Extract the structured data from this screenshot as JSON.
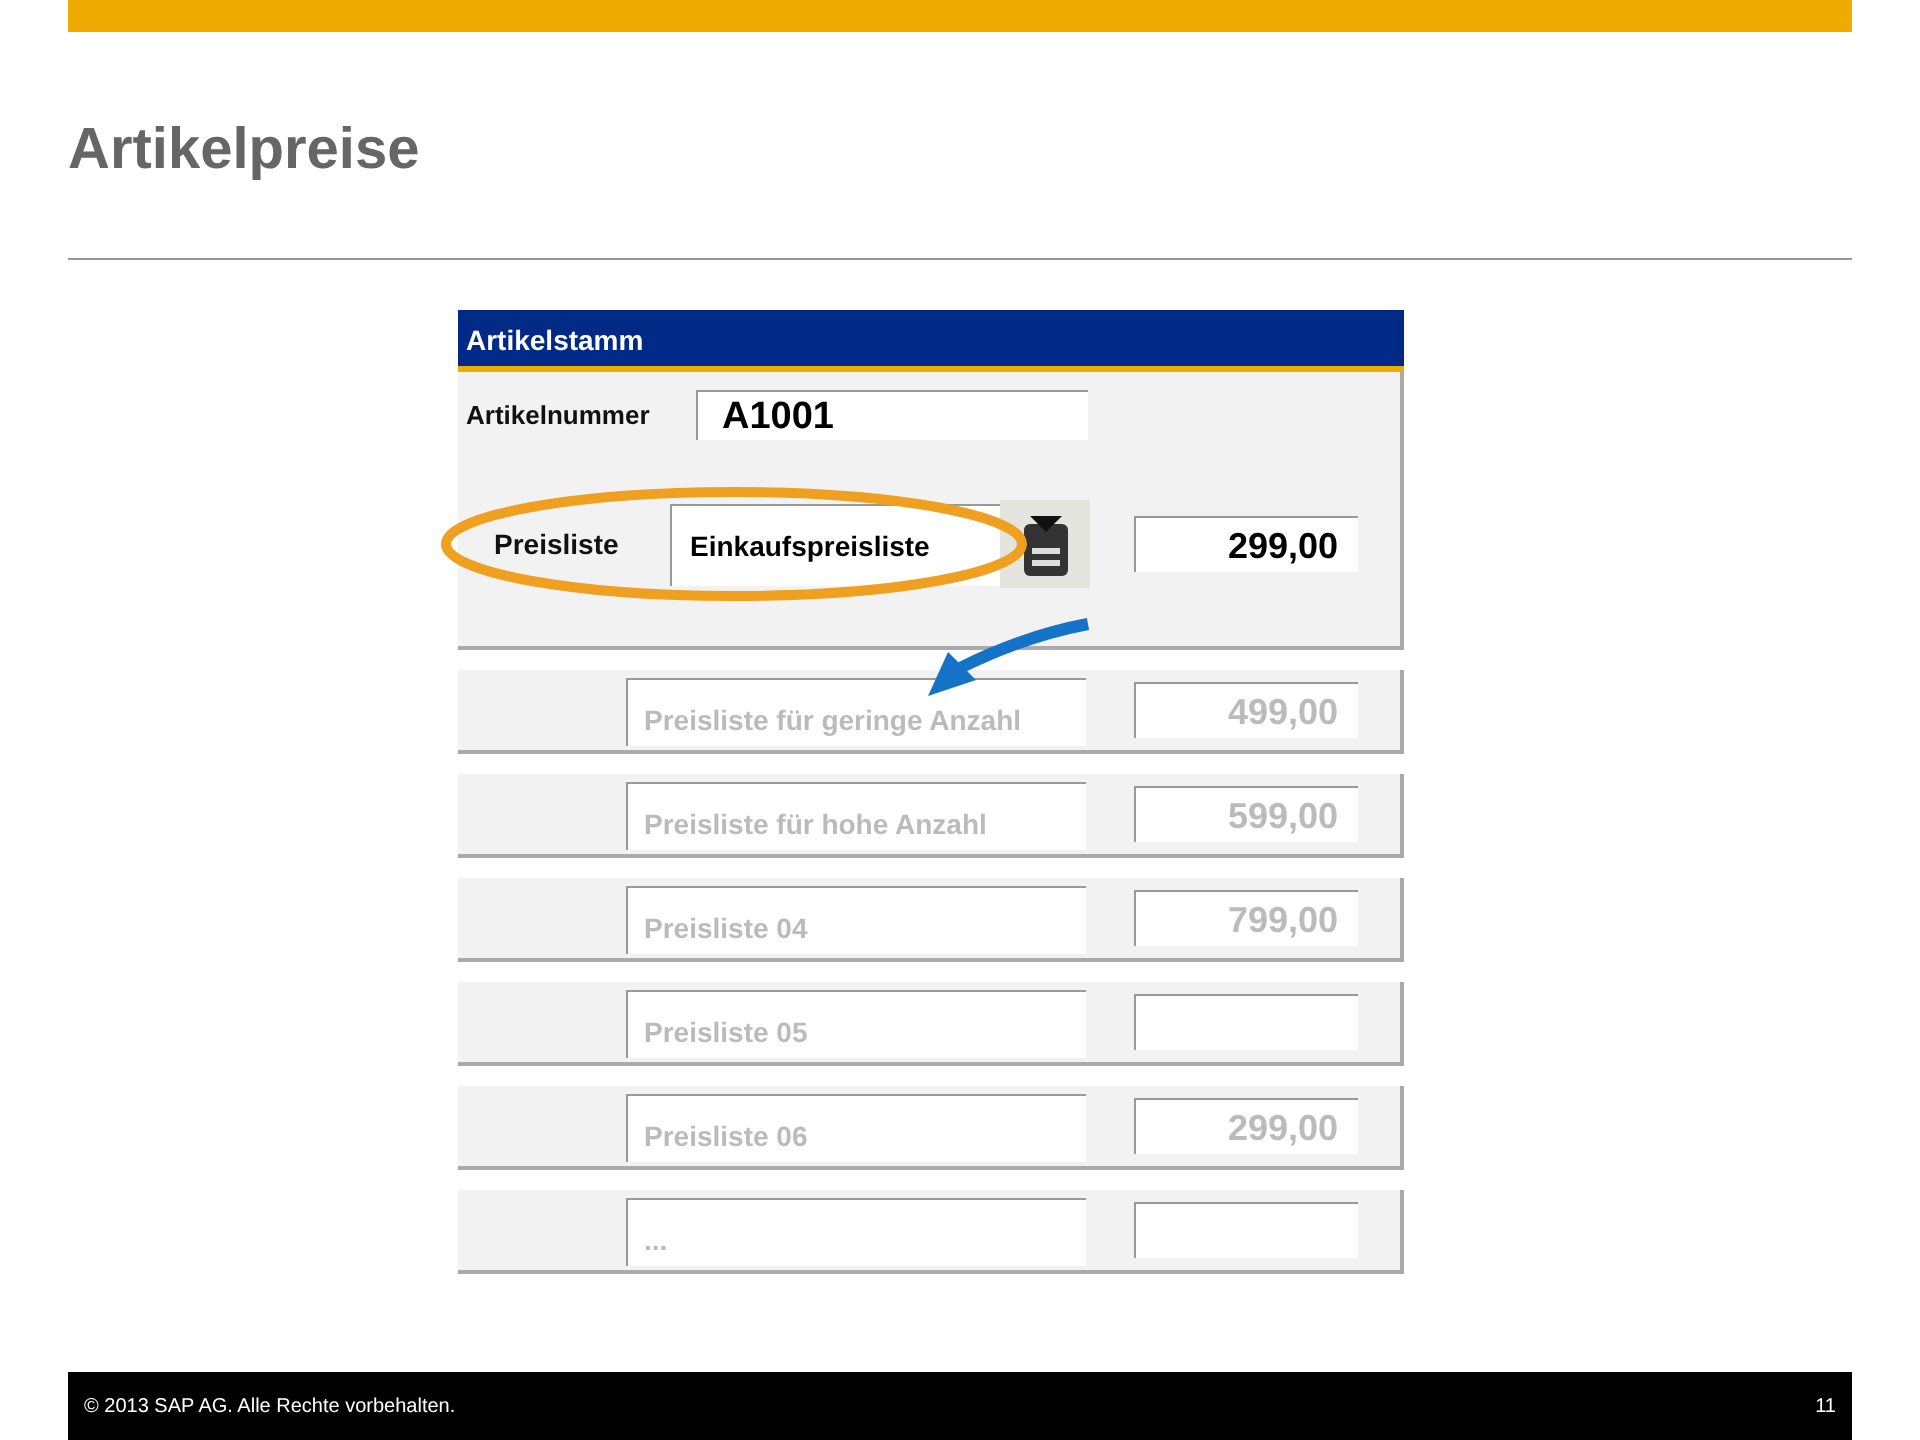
{
  "title": "Artikelpreise",
  "form": {
    "header": "Artikelstamm",
    "article_label": "Artikelnummer",
    "article_value": "A1001",
    "pricelist_label": "Preisliste",
    "pricelist_value": "Einkaufspreisliste",
    "price": "299,00"
  },
  "price_lists": [
    {
      "name": "Preisliste für geringe Anzahl",
      "price": "499,00"
    },
    {
      "name": "Preisliste für hohe Anzahl",
      "price": "599,00"
    },
    {
      "name": "Preisliste 04",
      "price": "799,00"
    },
    {
      "name": "Preisliste 05"
    },
    {
      "name": "Preisliste 06",
      "price": "299,00"
    },
    {
      "name": "..."
    }
  ],
  "footer": {
    "copyright": "© 2013 SAP AG. Alle Rechte vorbehalten.",
    "page": "11"
  }
}
